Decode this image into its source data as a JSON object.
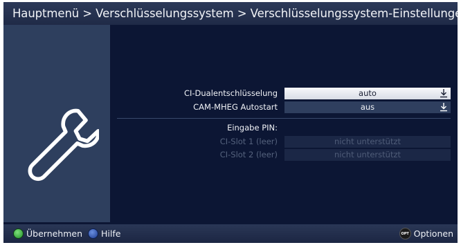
{
  "header": {
    "breadcrumb": "Hauptmenü > Verschlüsselungssystem > Verschlüsselungssystem-Einstellungen",
    "icon": "tv-icon"
  },
  "sidebar": {
    "icon": "wrench-icon"
  },
  "settings": [
    {
      "label": "CI-Dualentschlüsselung",
      "value": "auto",
      "state": "selected"
    },
    {
      "label": "CAM-MHEG Autostart",
      "value": "aus",
      "state": "normal"
    }
  ],
  "pin_section": {
    "heading": "Eingabe PIN:",
    "slots": [
      {
        "label": "CI-Slot 1 (leer)",
        "value": "nicht unterstützt"
      },
      {
        "label": "CI-Slot 2 (leer)",
        "value": "nicht unterstützt"
      }
    ]
  },
  "footer": {
    "accept_label": "Übernehmen",
    "help_label": "Hilfe",
    "options_label": "Optionen",
    "options_badge": "OPT"
  },
  "colors": {
    "background": "#0c1634",
    "panel": "#2e3f5e",
    "selected_bg": "#f7f8fb",
    "green_button": "#2fa33a",
    "blue_button": "#2a4fa8"
  }
}
